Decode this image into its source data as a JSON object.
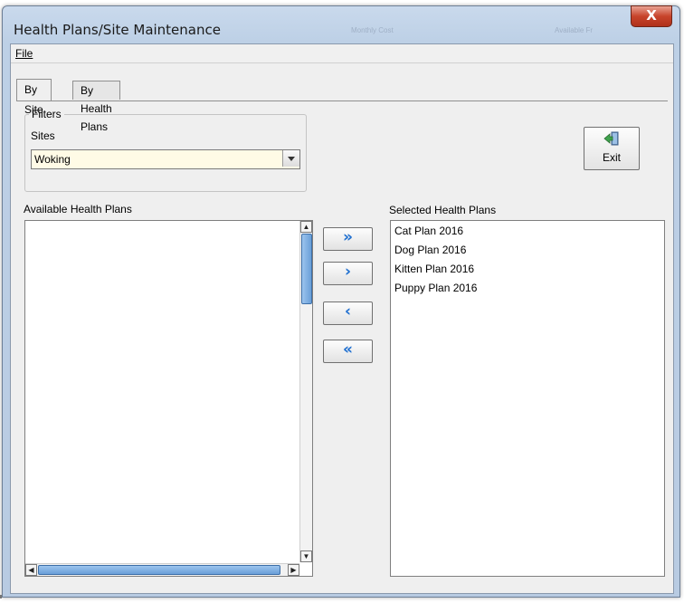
{
  "window": {
    "title": "Health Plans/Site Maintenance",
    "close_glyph": "X",
    "background_titles": [
      "Monthly Cost",
      "Available Fr"
    ]
  },
  "menu": {
    "file_label": "File"
  },
  "tabs": [
    {
      "label": "By Site",
      "active": true
    },
    {
      "label": "By Health Plans",
      "active": false
    }
  ],
  "filters": {
    "legend": "Filters",
    "sites_label": "Sites",
    "site_value": "Woking"
  },
  "exit_button": {
    "label": "Exit",
    "icon": "exit-door-icon"
  },
  "available": {
    "label": "Available Health Plans",
    "items": []
  },
  "selected": {
    "label": "Selected Health Plans",
    "items": [
      "Cat Plan 2016",
      "Dog Plan 2016",
      "Kitten Plan 2016",
      "Puppy Plan 2016"
    ]
  },
  "move_buttons": {
    "add_all": "»",
    "add_one": "›",
    "remove_one": "‹",
    "remove_all": "«"
  },
  "colors": {
    "accent": "#1f6fd0",
    "close": "#c7442b",
    "select_bg": "#fffbe6"
  }
}
